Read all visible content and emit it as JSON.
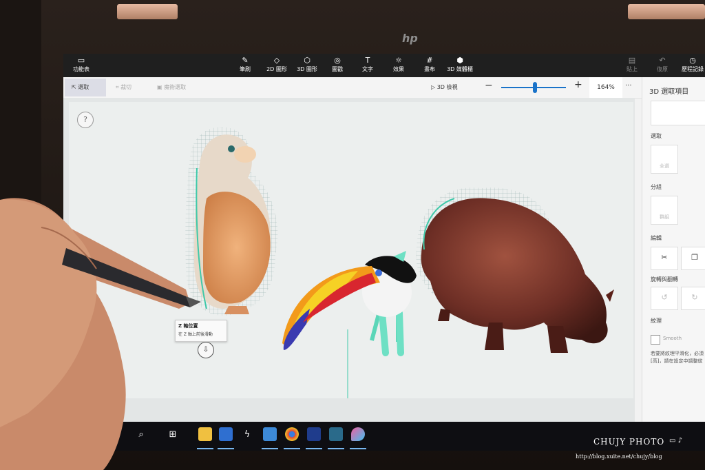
{
  "device": {
    "brand_logo": "hp",
    "colors": {
      "bezel": "#1a1411",
      "hinge": "#d9a98f",
      "accent": "#1a73c9"
    }
  },
  "app": {
    "menu_label": "功能表",
    "toolbar": [
      {
        "label": "筆刷",
        "icon": "brush-icon",
        "glyph": "✎"
      },
      {
        "label": "2D 圖形",
        "icon": "2d-shapes-icon",
        "glyph": "◇"
      },
      {
        "label": "3D 圖形",
        "icon": "3d-shapes-icon",
        "glyph": "⬡"
      },
      {
        "label": "圖戳",
        "icon": "stickers-icon",
        "glyph": "◎"
      },
      {
        "label": "文字",
        "icon": "text-icon",
        "glyph": "T"
      },
      {
        "label": "效果",
        "icon": "effects-icon",
        "glyph": "☼"
      },
      {
        "label": "畫布",
        "icon": "canvas-icon",
        "glyph": "#"
      },
      {
        "label": "3D 媒體櫃",
        "icon": "3d-library-icon",
        "glyph": "⬢"
      }
    ],
    "toolbar_right": [
      {
        "label": "貼上",
        "icon": "paste-icon",
        "glyph": "▤"
      },
      {
        "label": "復原",
        "icon": "undo-icon",
        "glyph": "↶"
      },
      {
        "label": "歷程記錄",
        "icon": "history-icon",
        "glyph": "◷"
      }
    ],
    "subbar": {
      "select": "選取",
      "crop": "裁切",
      "magic_select": "魔術選取",
      "view_3d": "3D 檢視",
      "zoom": "164%",
      "zoom_level": 0.5
    },
    "panel": {
      "title": "3D 選取項目",
      "sections": {
        "select": "選取",
        "select_all": "全選",
        "group": "分組",
        "group_btn": "群組",
        "edit": "編輯",
        "rotate_flip": "旋轉與翻轉",
        "texture": "紋理",
        "smooth": "Smooth",
        "texture_note": "若要將紋理平滑化，必須 [高]，請在設定中調整紋"
      }
    },
    "tooltip": {
      "title": "Z 軸位置",
      "description": "在 Z 軸上前後滑動"
    },
    "help": "?"
  },
  "taskbar": {
    "icons": [
      "back-icon",
      "search-icon",
      "task-view-icon",
      "file-explorer-icon",
      "store-icon",
      "lightning-app-icon",
      "photos-icon",
      "chrome-icon",
      "powershell-icon",
      "ms-app-icon",
      "paint-3d-icon"
    ]
  },
  "watermark": {
    "name": "CHUJY PHOTO",
    "url": "http://blog.xuite.net/chujy/blog"
  }
}
